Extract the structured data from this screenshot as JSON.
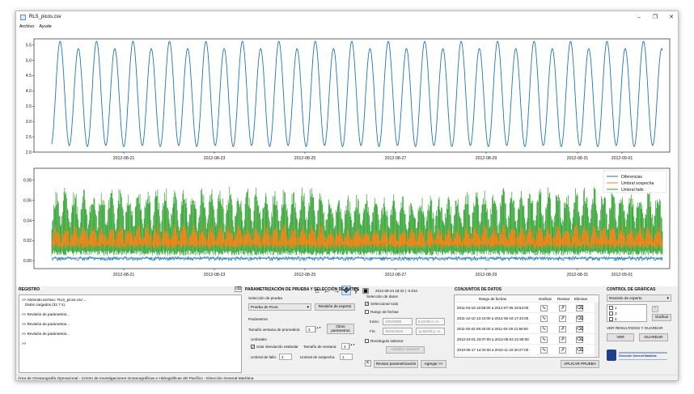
{
  "window": {
    "title": "RLS_picos.csv",
    "menu": [
      "Archivo",
      "Ayude"
    ],
    "controls": [
      "–",
      "❐",
      "✕"
    ]
  },
  "plot1": {
    "yticks": [
      "5.5",
      "5.0",
      "4.5",
      "4.0",
      "3.5",
      "3.0",
      "2.5",
      "2.0"
    ],
    "xticks": [
      "2012-08-21",
      "2012-08-23",
      "2012-08-25",
      "2012-08-27",
      "2012-08-29",
      "2012-08-31",
      "2012-09-01"
    ]
  },
  "plot2": {
    "yticks": [
      "0.08",
      "0.06",
      "0.04",
      "0.02",
      "0.00"
    ],
    "xticks": [
      "2012-08-21",
      "2012-08-23",
      "2012-08-25",
      "2012-08-27",
      "2012-08-29",
      "2012-08-31",
      "2012-09-01"
    ],
    "legend": [
      {
        "name": "Diferencias",
        "color": "#1f77b4"
      },
      {
        "name": "Umbral sospecha",
        "color": "#ff7f0e"
      },
      {
        "name": "Umbral fallo",
        "color": "#2ca02c"
      }
    ]
  },
  "colors": {
    "series": "#1f77b4",
    "orange": "#ff7f0e",
    "green": "#2ca02c"
  },
  "toolbar": {
    "icons": [
      "home-icon",
      "back-icon",
      "forward-icon",
      "pan-icon",
      "zoom-icon",
      "save-icon"
    ],
    "glyphs": [
      "⌂",
      "←",
      "→",
      "✥",
      "⚲",
      "▣"
    ],
    "coords": "2012-08-24 18:32 | -0.010"
  },
  "registro": {
    "title": "REGISTRO",
    "lines": [
      ">> Abriendo archivo: 'RLS_picos.csv'...",
      "   Datos cargados (32.7 s).",
      "",
      ">> Revisión de parámetros...",
      "",
      ">> Revisión de parámetros...",
      "",
      ">> Revisión de parámetros...",
      "",
      ">>"
    ]
  },
  "param": {
    "title": "PARAMETRIZACIÓN DE PRUEBA Y SELECCIÓN DE DATOS",
    "seleccion_prueba": "Selección de prueba",
    "prueba_value": "Prueba de Picos",
    "revision_experto_btn": "Revisión de experto",
    "parametros": "Parámetros",
    "tam_ventana_label": "Tamaño ventana de promedios:",
    "tam_ventana_value": "3",
    "otros_btn": "Otros parámetros",
    "umbrales": "Umbrales",
    "usar_desv_label": "Usar desviación estándar",
    "tam_ventana2_label": "Tamaño de ventana:",
    "tam_ventana2_value": "3",
    "umbral_fallo_label": "Umbral de fallo:",
    "umbral_fallo_value": "2",
    "umbral_sospecha_label": "Umbral de sospecha:",
    "umbral_sospecha_value": "1",
    "revisar_btn": "Revisar parametrización",
    "agregar_btn": "Agregar >>"
  },
  "seleccion_datos": {
    "title": "Selección de datos",
    "seleccionar_todo": "Seleccionar todo",
    "rango_fechas": "Rango de fechas",
    "inicio_label": "Inicio:",
    "inicio_fecha": "1/02/2009",
    "inicio_hora": "6:24:00 a. m.",
    "fin_label": "Fin:",
    "fin_fecha": "30/11/2020",
    "fin_hora": "11:59:00 p. m.",
    "rectangulo": "Rectángulo selector",
    "habilitar_btn": "Habilitar Selector"
  },
  "conjuntos": {
    "title": "CONJUNTOS DE DATOS",
    "headers": [
      "Rango de fechas",
      "Graficar",
      "Revisar",
      "Eliminar"
    ],
    "rows": [
      "2011-04-18 15:59:00 a 2012-07-09 15:54:00",
      "2011-12-10 12:44:00 a 2012-06-18 17:42:00",
      "2011-02-02 06:40:00 a 2011-04-29 21:59:00",
      "2012-03-01 23:07:00 a 2012-05-04 22:59:00",
      "2010-06-17 14:34:00 a 2010-11-19 20:27:00"
    ],
    "aplicar_btn": "APLICAR PRUEBA"
  },
  "control": {
    "title": "CONTROL DE GRÁFICAS",
    "select_value": "Revisión de experto",
    "checks": [
      "1",
      "3",
      "4"
    ],
    "graficar_btn": "Graficar",
    "ver_guardar": "VER RESULTADOS Y GUARDAR",
    "ver_btn": "VER",
    "guardar_btn": "GUARDAR",
    "logo_text": "Dirección General Marítima"
  },
  "status": "Área de Oceanografía Operacional - Centro de Investigaciones Oceanográficas e Hidrográficas del Pacífico - Dirección General Marítima"
}
